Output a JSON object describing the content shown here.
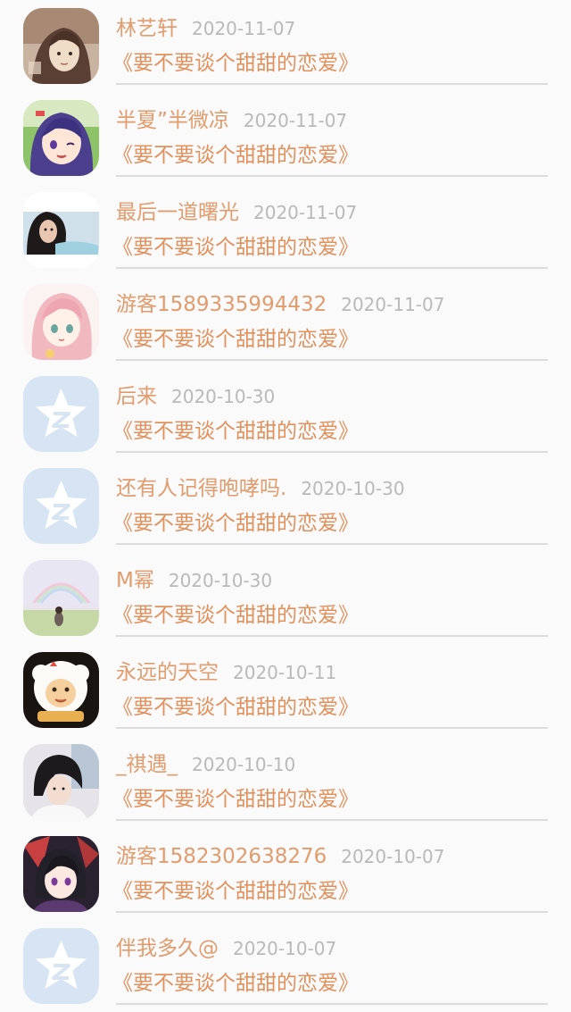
{
  "comments": [
    {
      "name": "林艺轩",
      "date": "2020-11-07",
      "message": "《要不要谈个甜甜的恋爱》",
      "avatar": "sepia-portrait-avatar"
    },
    {
      "name": "半夏”半微凉",
      "date": "2020-11-07",
      "message": "《要不要谈个甜甜的恋爱》",
      "avatar": "anime-girl-purple-hair-avatar"
    },
    {
      "name": "最后一道曙光",
      "date": "2020-11-07",
      "message": "《要不要谈个甜甜的恋爱》",
      "avatar": "woman-photo-avatar"
    },
    {
      "name": "游客1589335994432",
      "date": "2020-11-07",
      "message": "《要不要谈个甜甜的恋爱》",
      "avatar": "anime-girl-pink-hair-avatar"
    },
    {
      "name": "后来",
      "date": "2020-10-30",
      "message": "《要不要谈个甜甜的恋爱》",
      "avatar": "default-star-avatar"
    },
    {
      "name": "还有人记得咆哮吗.",
      "date": "2020-10-30",
      "message": "《要不要谈个甜甜的恋爱》",
      "avatar": "default-star-avatar"
    },
    {
      "name": "M幂",
      "date": "2020-10-30",
      "message": "《要不要谈个甜甜的恋爱》",
      "avatar": "rainbow-field-avatar"
    },
    {
      "name": "永远的天空",
      "date": "2020-10-11",
      "message": "《要不要谈个甜甜的恋爱》",
      "avatar": "cartoon-sheep-avatar"
    },
    {
      "name": "_祺遇_",
      "date": "2020-10-10",
      "message": "《要不要谈个甜甜的恋爱》",
      "avatar": "boy-photo-avatar"
    },
    {
      "name": "游客1582302638276",
      "date": "2020-10-07",
      "message": "《要不要谈个甜甜的恋爱》",
      "avatar": "anime-character-dark-avatar"
    },
    {
      "name": "伴我多久@",
      "date": "2020-10-07",
      "message": "《要不要谈个甜甜的恋爱》",
      "avatar": "default-star-avatar"
    }
  ],
  "colors": {
    "background": "#fbfafb",
    "name": "#e09c6c",
    "message": "#e0915c",
    "date": "#b9b9b9",
    "divider": "#dcdcdc",
    "default_avatar_bg": "#d6e4f3"
  }
}
